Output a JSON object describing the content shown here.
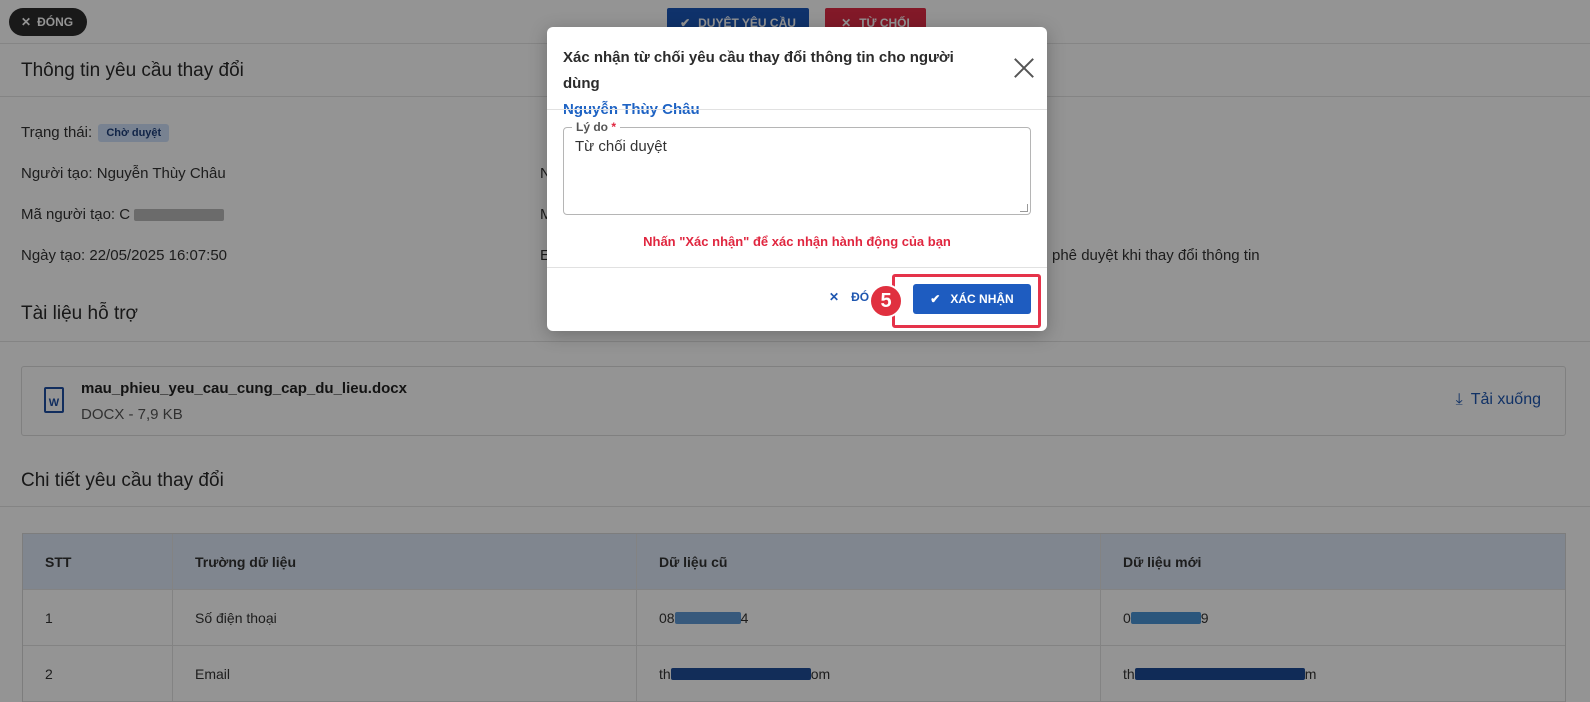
{
  "toolbar": {
    "close_label": "ĐÓNG",
    "approve_label": "DUYỆT YÊU CẦU",
    "reject_label": "TỪ CHỐI"
  },
  "info": {
    "section_title": "Thông tin yêu cầu thay đổi",
    "status_label": "Trạng thái:",
    "status_badge": "Chờ duyệt",
    "creator": "Người tạo: Nguyễn Thùy Châu",
    "creator_code": "Mã người tạo: C",
    "created_date": "Ngày tạo: 22/05/2025 16:07:50",
    "col2_row1": "N",
    "col2_row2": "M",
    "col2_row3": "E",
    "right_text": "phê duyệt khi thay đổi thông tin"
  },
  "docs": {
    "section_title": "Tài liệu hỗ trợ",
    "file_name": "mau_phieu_yeu_cau_cung_cap_du_lieu.docx",
    "file_meta": "DOCX - 7,9 KB",
    "file_icon_letter": "W",
    "download_label": "Tải xuống"
  },
  "details": {
    "section_title": "Chi tiết yêu cầu thay đổi",
    "columns": [
      "STT",
      "Trường dữ liệu",
      "Dữ liệu cũ",
      "Dữ liệu mới"
    ],
    "rows": [
      {
        "stt": "1",
        "field": "Số điện thoại",
        "old_prefix": "08",
        "old_suffix": "4",
        "new_prefix": "0",
        "new_suffix": "9"
      },
      {
        "stt": "2",
        "field": "Email",
        "old_prefix": "th",
        "old_suffix": "om",
        "new_prefix": "th",
        "new_suffix": "m"
      }
    ]
  },
  "modal": {
    "title": "Xác nhận từ chối yêu cầu thay đổi thông tin cho người dùng",
    "user": "Nguyễn Thùy Châu",
    "reason_label": "Lý do",
    "required_mark": "*",
    "reason_value": "Từ chối duyệt",
    "hint": "Nhấn \"Xác nhận\" để xác nhận hành động của bạn",
    "close_label": "ĐÓ",
    "confirm_label": "XÁC NHẬN",
    "step_number": "5"
  },
  "colors": {
    "primary": "#1e5cc0",
    "danger": "#e0263f",
    "badge_bg": "#cfe0fa"
  }
}
